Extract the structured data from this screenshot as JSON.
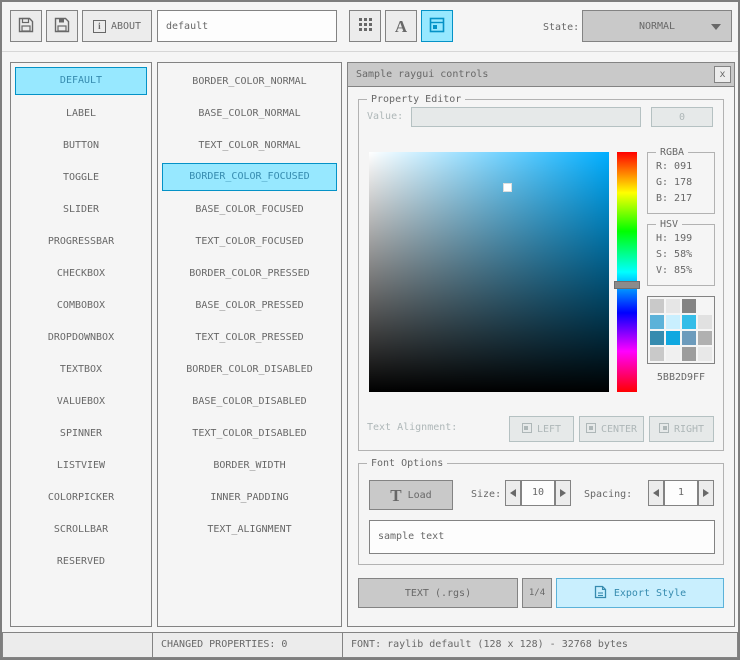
{
  "toolbar": {
    "about_label": "ABOUT",
    "name_value": "default",
    "state_label": "State:",
    "state_value": "NORMAL"
  },
  "controls_list": {
    "selected": "DEFAULT",
    "items": [
      "DEFAULT",
      "LABEL",
      "BUTTON",
      "TOGGLE",
      "SLIDER",
      "PROGRESSBAR",
      "CHECKBOX",
      "COMBOBOX",
      "DROPDOWNBOX",
      "TEXTBOX",
      "VALUEBOX",
      "SPINNER",
      "LISTVIEW",
      "COLORPICKER",
      "SCROLLBAR",
      "RESERVED"
    ]
  },
  "properties_list": {
    "selected": "BORDER_COLOR_FOCUSED",
    "items": [
      "BORDER_COLOR_NORMAL",
      "BASE_COLOR_NORMAL",
      "TEXT_COLOR_NORMAL",
      "BORDER_COLOR_FOCUSED",
      "BASE_COLOR_FOCUSED",
      "TEXT_COLOR_FOCUSED",
      "BORDER_COLOR_PRESSED",
      "BASE_COLOR_PRESSED",
      "TEXT_COLOR_PRESSED",
      "BORDER_COLOR_DISABLED",
      "BASE_COLOR_DISABLED",
      "TEXT_COLOR_DISABLED",
      "BORDER_WIDTH",
      "INNER_PADDING",
      "TEXT_ALIGNMENT"
    ]
  },
  "sample_window": {
    "title": "Sample raygui controls",
    "close_label": "x",
    "property_editor": {
      "label": "Property Editor",
      "value_label": "Value:",
      "value_input": "",
      "value_button": "0",
      "hue_color": "#00aeff",
      "hsv_values": {
        "h": 199,
        "s": 58,
        "v": 85
      },
      "rgba": {
        "label": "RGBA",
        "r": "R: 091",
        "g": "G: 178",
        "b": "B: 217"
      },
      "hsv": {
        "label": "HSV",
        "h": "H: 199",
        "s": "S: 58%",
        "v": "V: 85%"
      },
      "hex": "5BB2D9FF",
      "swatches": [
        "#c9c9c9",
        "#e6e6e6",
        "#848484",
        "#f5f5f5",
        "#5bb2d9",
        "#c9effe",
        "#35bde8",
        "#e1e1e1",
        "#368baf",
        "#10a8e0",
        "#6c9bbc",
        "#b0b0b0",
        "#c9c9c9",
        "#f0f0f0",
        "#9d9d9d",
        "#e8e8e8"
      ],
      "text_alignment_label": "Text Alignment:",
      "align_left": "LEFT",
      "align_center": "CENTER",
      "align_right": "RIGHT"
    },
    "font_options": {
      "label": "Font Options",
      "load_label": "Load",
      "size_label": "Size:",
      "size_value": "10",
      "spacing_label": "Spacing:",
      "spacing_value": "1",
      "sample_text": "sample text"
    },
    "export_row": {
      "format_button": "TEXT (.rgs)",
      "pager": "1/4",
      "export_button": "Export Style"
    }
  },
  "statusbar": {
    "changed": "CHANGED PROPERTIES: 0",
    "font_info": "FONT: raylib default (128 x 128) - 32768 bytes"
  },
  "colors": {
    "accent": "#0492c7",
    "selected_bg": "#97e8ff",
    "selected_text": "#368baf",
    "focused_border": "#5bb2d9",
    "focused_bg": "#c9effe",
    "border": "#838383",
    "text": "#686868",
    "current_color": "#5bb2d9"
  }
}
